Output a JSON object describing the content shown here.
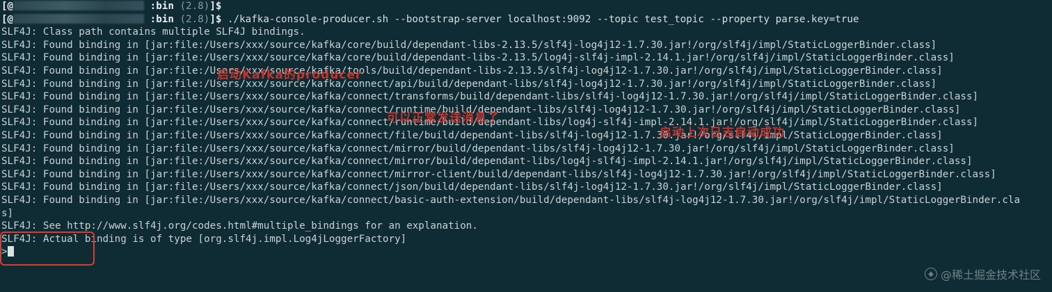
{
  "terminal": {
    "prompt1": {
      "user_prefix": "[@",
      "dir": " :bin",
      "version": " (2.8)",
      "suffix": "]$"
    },
    "prompt2": {
      "user_prefix": "[@",
      "dir": " :bin",
      "version": " (2.8)",
      "suffix": "]$",
      "command": " ./kafka-console-producer.sh --bootstrap-server localhost:9092 --topic test_topic --property parse.key=true"
    },
    "output_lines": [
      "SLF4J: Class path contains multiple SLF4J bindings.",
      "SLF4J: Found binding in [jar:file:/Users/xxx/source/kafka/core/build/dependant-libs-2.13.5/slf4j-log4j12-1.7.30.jar!/org/slf4j/impl/StaticLoggerBinder.class]",
      "SLF4J: Found binding in [jar:file:/Users/xxx/source/kafka/core/build/dependant-libs-2.13.5/log4j-slf4j-impl-2.14.1.jar!/org/slf4j/impl/StaticLoggerBinder.class]",
      "SLF4J: Found binding in [jar:file:/Users/xxx/source/kafka/tools/build/dependant-libs-2.13.5/slf4j-log4j12-1.7.30.jar!/org/slf4j/impl/StaticLoggerBinder.class]",
      "SLF4J: Found binding in [jar:file:/Users/xxx/source/kafka/connect/api/build/dependant-libs/slf4j-log4j12-1.7.30.jar!/org/slf4j/impl/StaticLoggerBinder.class]",
      "SLF4J: Found binding in [jar:file:/Users/xxx/source/kafka/connect/transforms/build/dependant-libs/slf4j-log4j12-1.7.30.jar!/org/slf4j/impl/StaticLoggerBinder.class]",
      "SLF4J: Found binding in [jar:file:/Users/xxx/source/kafka/connect/runtime/build/dependant-libs/slf4j-log4j12-1.7.30.jar!/org/slf4j/impl/StaticLoggerBinder.class]",
      "SLF4J: Found binding in [jar:file:/Users/xxx/source/kafka/connect/runtime/build/dependant-libs/log4j-slf4j-impl-2.14.1.jar!/org/slf4j/impl/StaticLoggerBinder.class]",
      "SLF4J: Found binding in [jar:file:/Users/xxx/source/kafka/connect/file/build/dependant-libs/slf4j-log4j12-1.7.30.jar!/org/slf4j/impl/StaticLoggerBinder.class]",
      "SLF4J: Found binding in [jar:file:/Users/xxx/source/kafka/connect/mirror/build/dependant-libs/slf4j-log4j12-1.7.30.jar!/org/slf4j/impl/StaticLoggerBinder.class]",
      "SLF4J: Found binding in [jar:file:/Users/xxx/source/kafka/connect/mirror/build/dependant-libs/log4j-slf4j-impl-2.14.1.jar!/org/slf4j/impl/StaticLoggerBinder.class]",
      "SLF4J: Found binding in [jar:file:/Users/xxx/source/kafka/connect/mirror-client/build/dependant-libs/slf4j-log4j12-1.7.30.jar!/org/slf4j/impl/StaticLoggerBinder.class]",
      "SLF4J: Found binding in [jar:file:/Users/xxx/source/kafka/connect/json/build/dependant-libs/slf4j-log4j12-1.7.30.jar!/org/slf4j/impl/StaticLoggerBinder.class]",
      "SLF4J: Found binding in [jar:file:/Users/xxx/source/kafka/connect/basic-auth-extension/build/dependant-libs/slf4j-log4j12-1.7.30.jar!/org/slf4j/impl/StaticLoggerBinder.cla",
      "s]",
      "SLF4J: See http://www.slf4j.org/codes.html#multiple_bindings for an explanation.",
      "SLF4J: Actual binding is of type [org.slf4j.impl.Log4jLoggerFactory]"
    ],
    "cursor_prompt": ">"
  },
  "annotations": [
    "启动Kafka的producer",
    "可以正常发送消息了",
    "启动上次日志启动成功"
  ],
  "watermark": {
    "icon": "juejin-logo-icon",
    "text": "@稀土掘金技术社区"
  },
  "colors": {
    "background": "#0f2b34",
    "text": "#c9d3d6",
    "annotation": "#d1362f",
    "highlight_box": "#e03a2e"
  }
}
